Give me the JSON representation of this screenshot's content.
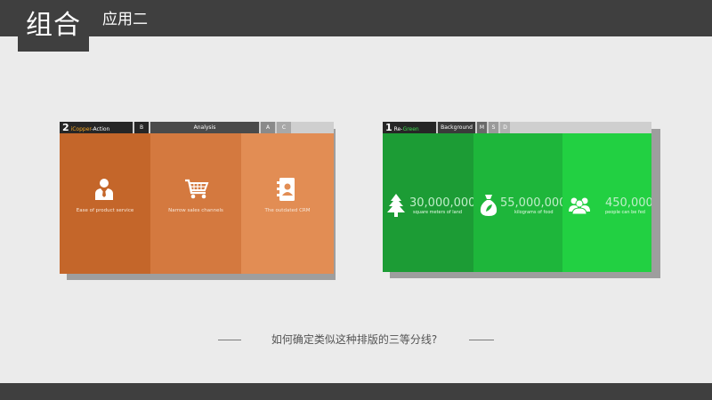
{
  "header": {
    "title": "组合",
    "subtitle": "应用二"
  },
  "left_card": {
    "tabs": {
      "number": "2",
      "brand_a": "iCopper",
      "brand_sep": "-",
      "brand_b": "Action",
      "tab_b": "B",
      "tab_analysis": "Analysis",
      "tab_a": "A",
      "tab_c": "C"
    },
    "panels": [
      {
        "caption": "Ease of product service",
        "icon": "businessman-icon"
      },
      {
        "caption": "Narrow sales channels",
        "icon": "shopping-cart-icon"
      },
      {
        "caption": "The outdated CRM",
        "icon": "address-book-icon"
      }
    ],
    "colors": {
      "panel1": "#c4662a",
      "panel2": "#d4793f",
      "panel3": "#e28d54",
      "tab_dark": "#262626",
      "tab_mid": "#5a5a5a",
      "brand_a": "#f5a623"
    }
  },
  "right_card": {
    "tabs": {
      "number": "1",
      "brand_a": "Re-",
      "brand_b": "Green",
      "tab_background": "Background",
      "tab_m": "M",
      "tab_s": "S",
      "tab_d": "D"
    },
    "panels": [
      {
        "number": "30,000,000",
        "caption": "square meters of land",
        "icon": "tree-icon"
      },
      {
        "number": "55,000,000",
        "caption": "kilograms of food",
        "icon": "sack-icon"
      },
      {
        "number": "450,000",
        "caption": "people can be fed",
        "icon": "people-icon"
      }
    ],
    "colors": {
      "panel1": "#1c9c35",
      "panel2": "#1eb63b",
      "panel3": "#22d042",
      "brand_b": "#3ddc4f"
    }
  },
  "footer": {
    "question": "如何确定类似这种排版的三等分线?"
  }
}
